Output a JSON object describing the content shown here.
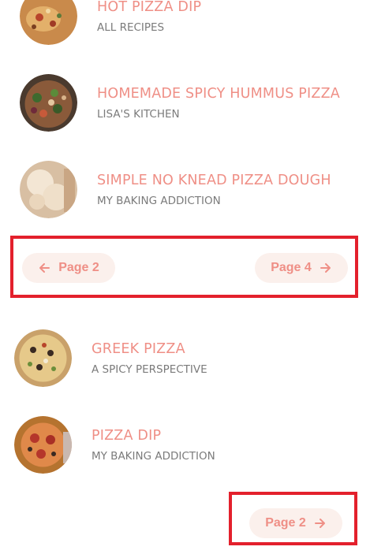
{
  "recipes": [
    {
      "title": "HOT PIZZA DIP",
      "source": "ALL RECIPES",
      "icon": "pizza-dip-thumbnail"
    },
    {
      "title": "HOMEMADE SPICY HUMMUS PIZZA",
      "source": "LISA'S KITCHEN",
      "icon": "hummus-pizza-thumbnail"
    },
    {
      "title": "SIMPLE NO KNEAD PIZZA DOUGH",
      "source": "MY BAKING ADDICTION",
      "icon": "pizza-dough-thumbnail"
    },
    {
      "title": "GREEK PIZZA",
      "source": "A SPICY PERSPECTIVE",
      "icon": "greek-pizza-thumbnail"
    },
    {
      "title": "PIZZA DIP",
      "source": "MY BAKING ADDICTION",
      "icon": "pizza-dip-thumbnail"
    }
  ],
  "pagination_top": {
    "prev_label": "Page 2",
    "next_label": "Page 4"
  },
  "pagination_bottom": {
    "next_label": "Page 2"
  },
  "colors": {
    "title": "#ef8f86",
    "source": "#7b7b7b",
    "pill_bg": "#fbf0ec",
    "highlight": "#e3202c"
  }
}
